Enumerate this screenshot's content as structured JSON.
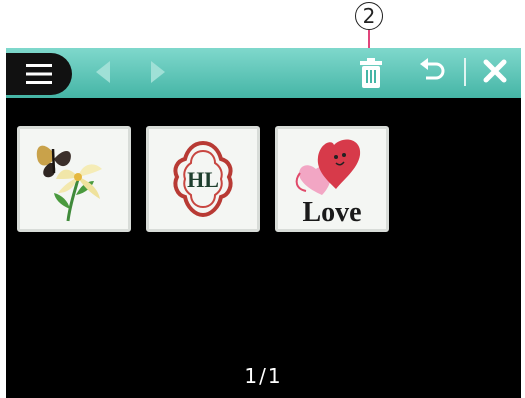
{
  "callout": {
    "number": "2"
  },
  "toolbar": {
    "menu_icon": "hamburger-icon",
    "prev_icon": "arrow-left-icon",
    "next_icon": "arrow-right-icon",
    "delete_icon": "trash-icon",
    "undo_icon": "undo-icon",
    "close_icon": "close-icon",
    "colors": {
      "bar": "#4fbfb0",
      "icons": "#ffffff",
      "menu_bg": "#111111"
    }
  },
  "thumbnails": [
    {
      "name": "butterfly-lily"
    },
    {
      "name": "monogram-frame",
      "text": "HL"
    },
    {
      "name": "love-heart",
      "text": "Love"
    }
  ],
  "pagination": {
    "label": "1/1"
  }
}
